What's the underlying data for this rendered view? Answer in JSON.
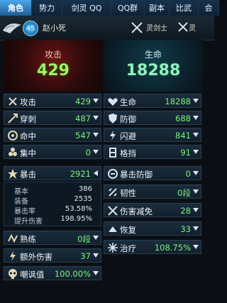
{
  "tabs": [
    "角色",
    "势力",
    "剑灵 QQ",
    "QQ群",
    "副本",
    "比武",
    "会"
  ],
  "header": {
    "level": "45",
    "player_name": "赵小死",
    "class_left": "灵剑士",
    "class_right": "灵"
  },
  "summary": {
    "attack_label": "攻击",
    "attack_value": "429",
    "hp_label": "生命",
    "hp_value": "18288"
  },
  "left_stats": [
    {
      "label": "攻击",
      "value": "429",
      "icon": "crossed-swords-icon"
    },
    {
      "label": "穿刺",
      "value": "487",
      "icon": "pierce-icon"
    },
    {
      "label": "命中",
      "value": "547",
      "icon": "target-icon"
    },
    {
      "label": "集中",
      "value": "0",
      "icon": "focus-icon"
    },
    {
      "label": "暴击",
      "value": "2921",
      "icon": "critical-icon"
    }
  ],
  "critical_details": [
    {
      "label": "基本",
      "value": "386"
    },
    {
      "label": "装备",
      "value": "2535"
    },
    {
      "label": "暴击率",
      "value": "53.58%"
    },
    {
      "label": "提升伤害",
      "value": "198.95%"
    }
  ],
  "left_stats_bottom": [
    {
      "label": "熟练",
      "value": "0段",
      "icon": "mastery-icon"
    },
    {
      "label": "额外伤害",
      "value": "37",
      "icon": "extra-damage-icon"
    },
    {
      "label": "嘲讽值",
      "value": "100.00%",
      "icon": "skull-icon"
    }
  ],
  "right_stats": [
    {
      "label": "生命",
      "value": "18288",
      "icon": "heart-icon"
    },
    {
      "label": "防御",
      "value": "688",
      "icon": "shield-icon"
    },
    {
      "label": "闪避",
      "value": "841",
      "icon": "evade-icon"
    },
    {
      "label": "格挡",
      "value": "91",
      "icon": "block-icon"
    },
    {
      "label": "暴击防御",
      "value": "0",
      "icon": "crit-defense-icon"
    },
    {
      "label": "韧性",
      "value": "0段",
      "icon": "toughness-icon"
    },
    {
      "label": "伤害减免",
      "value": "28",
      "icon": "damage-reduction-icon"
    },
    {
      "label": "恢复",
      "value": "33",
      "icon": "recovery-icon"
    },
    {
      "label": "治疗",
      "value": "108.75%",
      "icon": "heal-icon"
    }
  ]
}
